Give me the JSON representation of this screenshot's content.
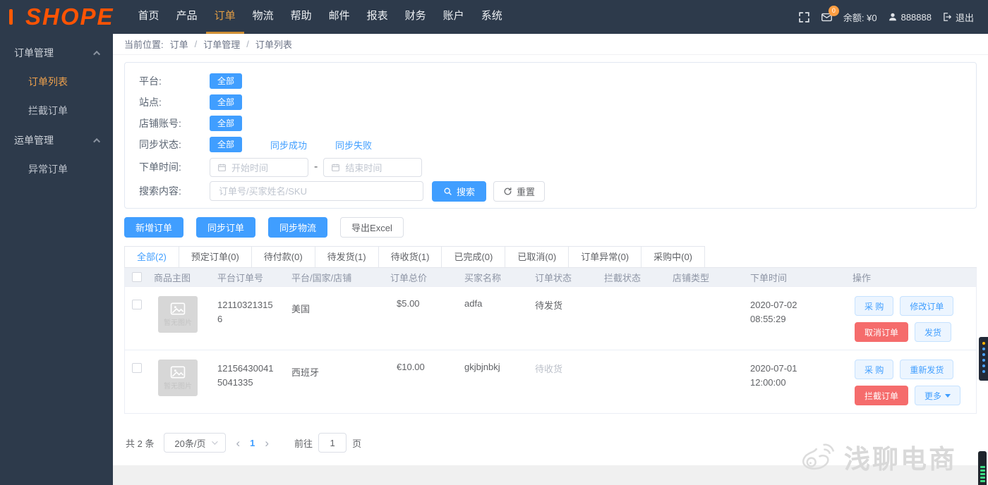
{
  "header": {
    "logo": "SHOPE",
    "nav": [
      "首页",
      "产品",
      "订单",
      "物流",
      "帮助",
      "邮件",
      "报表",
      "财务",
      "账户",
      "系统"
    ],
    "active_nav": "订单",
    "badge_count": "0",
    "balance": "余额: ¥0",
    "username": "888888",
    "logout_label": "退出"
  },
  "sidebar": {
    "groups": [
      {
        "label": "订单管理",
        "items": [
          "订单列表",
          "拦截订单"
        ]
      },
      {
        "label": "运单管理",
        "items": [
          "异常订单"
        ]
      }
    ],
    "active_item": "订单列表"
  },
  "breadcrumb": {
    "prefix": "当前位置:",
    "separator": "/",
    "items": [
      "订单",
      "订单管理",
      "订单列表"
    ]
  },
  "filters": {
    "platform_label": "平台:",
    "site_label": "站点:",
    "shop_label": "店铺账号:",
    "sync_label": "同步状态:",
    "all_label": "全部",
    "sync_success": "同步成功",
    "sync_fail": "同步失败",
    "order_time_label": "下单时间:",
    "start_placeholder": "开始时间",
    "end_placeholder": "结束时间",
    "range_separator": "-",
    "search_label": "搜索内容:",
    "search_placeholder": "订单号/买家姓名/SKU",
    "search_button": "搜索",
    "reset_button": "重置"
  },
  "actions": {
    "add_order": "新增订单",
    "sync_orders": "同步订单",
    "sync_logistics": "同步物流",
    "export_excel": "导出Excel"
  },
  "tabs": [
    "全部(2)",
    "预定订单(0)",
    "待付款(0)",
    "待发货(1)",
    "待收货(1)",
    "已完成(0)",
    "已取消(0)",
    "订单异常(0)",
    "采购中(0)"
  ],
  "active_tab": "全部(2)",
  "table": {
    "headers": [
      "商品主图",
      "平台订单号",
      "平台/国家/店铺",
      "订单总价",
      "买家名称",
      "订单状态",
      "拦截状态",
      "店铺类型",
      "下单时间",
      "操作"
    ],
    "no_image_label": "暂无图片",
    "rows": [
      {
        "order_no": "121103213156",
        "country": "美国",
        "total": "$5.00",
        "buyer": "adfa",
        "status": "待发货",
        "date": "2020-07-02",
        "time": "08:55:29",
        "actions": [
          "采 购",
          "修改订单",
          "取消订单",
          "发货"
        ]
      },
      {
        "order_no": "121564300415041335",
        "country": "西班牙",
        "total": "€10.00",
        "buyer": "gkjbjnbkj",
        "status": "待收货",
        "date": "2020-07-01",
        "time": "12:00:00",
        "actions": [
          "采 购",
          "重新发货",
          "拦截订单",
          "更多"
        ]
      }
    ]
  },
  "pagination": {
    "total": "共 2 条",
    "page_size": "20条/页",
    "prev": "‹",
    "page": "1",
    "next": "›",
    "goto_label": "前往",
    "goto_value": "1",
    "unit_label": "页"
  },
  "watermark": "浅聊电商",
  "colors": {
    "primary": "#409eff",
    "danger": "#f56c6c",
    "brand_orange": "#ff5303",
    "topbar_bg": "#2d3a4b",
    "active_nav": "#e29d44",
    "muted_status": "#bcc1ca"
  }
}
